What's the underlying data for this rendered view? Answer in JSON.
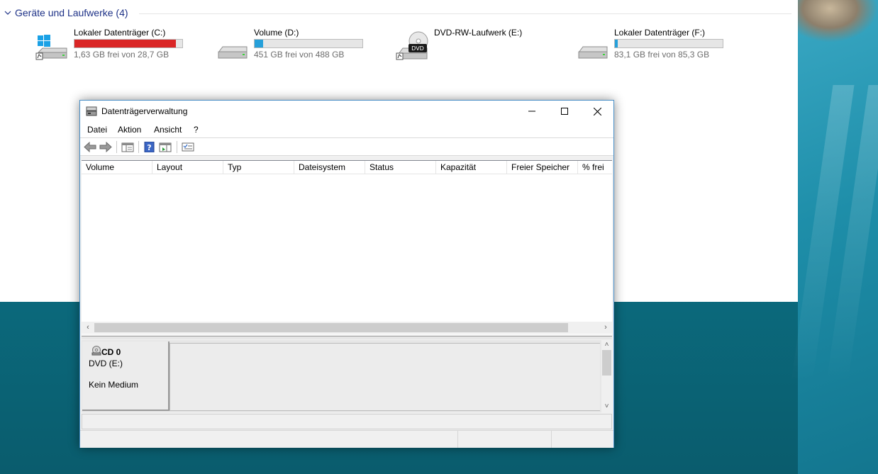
{
  "explorer": {
    "group_header": "Geräte und Laufwerke (4)",
    "drives": [
      {
        "name": "Lokaler Datenträger (C:)",
        "free": "1,63 GB frei von 28,7 GB",
        "used_fraction": 0.94,
        "bar_color": "#da2626",
        "icon": "windows-drive-icon"
      },
      {
        "name": "Volume (D:)",
        "free": "451 GB frei von 488 GB",
        "used_fraction": 0.076,
        "bar_color": "#26a0da",
        "icon": "hard-drive-icon"
      },
      {
        "name": "DVD-RW-Laufwerk (E:)",
        "free": "",
        "icon": "dvd-drive-icon",
        "dvd_label": "DVD"
      },
      {
        "name": "Lokaler Datenträger (F:)",
        "free": "83,1 GB frei von 85,3 GB",
        "used_fraction": 0.026,
        "bar_color": "#26a0da",
        "icon": "hard-drive-icon"
      }
    ]
  },
  "disk_management": {
    "title": "Datenträgerverwaltung",
    "menu": [
      "Datei",
      "Aktion",
      "Ansicht",
      "?"
    ],
    "columns": [
      "Volume",
      "Layout",
      "Typ",
      "Dateisystem",
      "Status",
      "Kapazität",
      "Freier Speicher",
      "% frei"
    ],
    "rows": [],
    "disk": {
      "name": "CD 0",
      "type": "DVD (E:)",
      "status": "Kein Medium"
    },
    "window_controls": {
      "minimize": "—",
      "maximize": "☐",
      "close": "✕"
    }
  },
  "colors": {
    "accent": "#1e3287",
    "window_border": "#4a90c8",
    "drive_bar_full": "#da2626",
    "drive_bar_normal": "#26a0da"
  }
}
